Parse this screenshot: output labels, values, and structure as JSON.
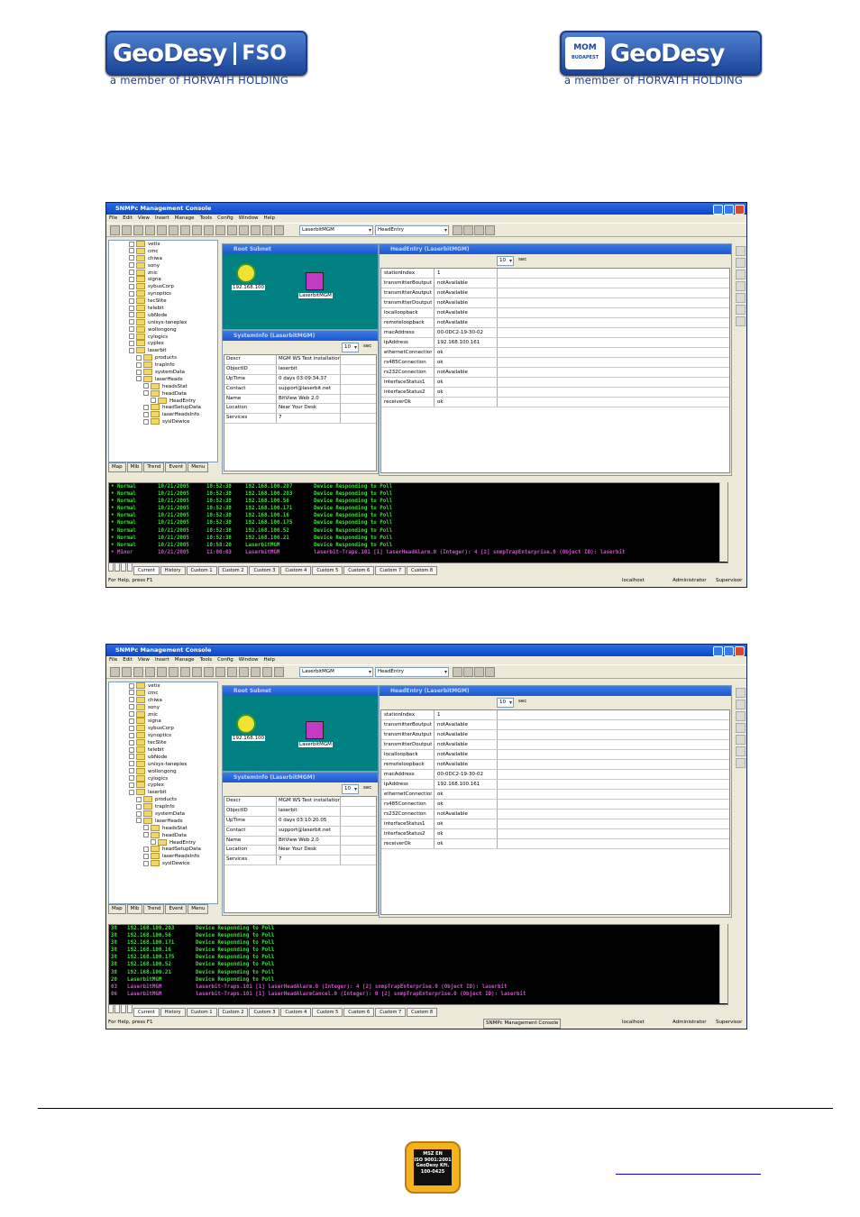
{
  "logos": {
    "left": {
      "brand": "GeoDesy",
      "suffix": "FSO",
      "tagline": "a member of HORVÁTH HOLDING"
    },
    "right": {
      "badge_top": "MOM",
      "badge_bottom": "BUDAPEST",
      "brand": "GeoDesy",
      "tagline": "a member of HORVÁTH HOLDING"
    }
  },
  "window": {
    "title": "SNMPc Management Console",
    "menu": [
      "File",
      "Edit",
      "View",
      "Insert",
      "Manage",
      "Tools",
      "Config",
      "Window",
      "Help"
    ],
    "map_combo": "LaserbitMGM",
    "table_combo": "HeadEntry",
    "tree": [
      "vetix",
      "cmc",
      "chiwa",
      "sony",
      "znic",
      "signa",
      "sybusCorp",
      "synoptics",
      "tecSlite",
      "telebit",
      "ubNode",
      "unisys-taneplex",
      "wollongong",
      "cylogics",
      "cyplex",
      "laserbit",
      "products",
      "trapInfo",
      "systemData",
      "laserHeads",
      "headsStat",
      "headData",
      "HeadEntry",
      "headSetupData",
      "laserHeadsInfo",
      "syslDewice"
    ],
    "tree_tabs": [
      "Map",
      "Mib",
      "Trend",
      "Event",
      "Menu"
    ],
    "root_subnet_title": "Root Subnet",
    "node1_label": "192.168.100",
    "node2_label": "LaserbitMGM",
    "sysinfo_title": "SystemInfo (LaserbitMGM)",
    "poll_value": "10",
    "poll_unit": "sec",
    "sysinfo_rows_a": [
      {
        "k": "Descr",
        "v": "MGM WS Test installation"
      },
      {
        "k": "ObjectID",
        "v": "laserbit"
      },
      {
        "k": "UpTime",
        "v": "0 days 03:09:34.37"
      },
      {
        "k": "Contact",
        "v": "support@laserbit.net"
      },
      {
        "k": "Name",
        "v": "BitView Web 2.0"
      },
      {
        "k": "Location",
        "v": "Near Your Desk"
      },
      {
        "k": "Services",
        "v": "7"
      }
    ],
    "sysinfo_rows_b": [
      {
        "k": "Descr",
        "v": "MGM WS Test installation"
      },
      {
        "k": "ObjectID",
        "v": "laserbit"
      },
      {
        "k": "UpTime",
        "v": "0 days 03:10:20.05"
      },
      {
        "k": "Contact",
        "v": "support@laserbit.net"
      },
      {
        "k": "Name",
        "v": "BitView Web 2.0"
      },
      {
        "k": "Location",
        "v": "Near Your Desk"
      },
      {
        "k": "Services",
        "v": "7"
      }
    ],
    "headentry_title": "HeadEntry (LaserbitMGM)",
    "headentry_rows": [
      {
        "k": "stationIndex",
        "v": "1"
      },
      {
        "k": "transmitterBoutput",
        "v": "notAvailable"
      },
      {
        "k": "transmitterAoutput",
        "v": "notAvailable"
      },
      {
        "k": "transmitterDoutput",
        "v": "notAvailable"
      },
      {
        "k": "localloopback",
        "v": "notAvailable"
      },
      {
        "k": "remoteloopback",
        "v": "notAvailable"
      },
      {
        "k": "macAddress",
        "v": "00-0DC2-19-30-02"
      },
      {
        "k": "ipAddress",
        "v": "192.168.100.161"
      },
      {
        "k": "ethernetConnection",
        "v": "ok"
      },
      {
        "k": "rs485Connection",
        "v": "ok"
      },
      {
        "k": "rs232Connection",
        "v": "notAvailable"
      },
      {
        "k": "interfaceStatus1",
        "v": "ok"
      },
      {
        "k": "interfaceStatus2",
        "v": "ok"
      },
      {
        "k": "receiverOk",
        "v": "ok"
      }
    ],
    "console_a": [
      {
        "c1": "• Normal",
        "c2": "10/21/2005",
        "c3": "10:52:38",
        "c4": "192.168.100.207",
        "c5": "Device Responding to Poll",
        "color": "#3cde3c"
      },
      {
        "c1": "• Normal",
        "c2": "10/21/2005",
        "c3": "10:52:38",
        "c4": "192.168.100.203",
        "c5": "Device Responding to Poll",
        "color": "#3cde3c"
      },
      {
        "c1": "• Normal",
        "c2": "10/21/2005",
        "c3": "10:52:38",
        "c4": "192.168.100.56",
        "c5": "Device Responding to Poll",
        "color": "#3cde3c"
      },
      {
        "c1": "• Normal",
        "c2": "10/21/2005",
        "c3": "10:52:38",
        "c4": "192.168.100.171",
        "c5": "Device Responding to Poll",
        "color": "#3cde3c"
      },
      {
        "c1": "• Normal",
        "c2": "10/21/2005",
        "c3": "10:52:38",
        "c4": "192.168.100.16",
        "c5": "Device Responding to Poll",
        "color": "#3cde3c"
      },
      {
        "c1": "• Normal",
        "c2": "10/21/2005",
        "c3": "10:52:38",
        "c4": "192.168.100.175",
        "c5": "Device Responding to Poll",
        "color": "#3cde3c"
      },
      {
        "c1": "• Normal",
        "c2": "10/21/2005",
        "c3": "10:52:38",
        "c4": "192.168.100.52",
        "c5": "Device Responding to Poll",
        "color": "#3cde3c"
      },
      {
        "c1": "• Normal",
        "c2": "10/21/2005",
        "c3": "10:52:38",
        "c4": "192.168.100.21",
        "c5": "Device Responding to Poll",
        "color": "#3cde3c"
      },
      {
        "c1": "• Normal",
        "c2": "10/21/2005",
        "c3": "10:58:20",
        "c4": "LaserbitMGM",
        "c5": "Device Responding to Poll",
        "color": "#3cde3c"
      },
      {
        "c1": "• Minor",
        "c2": "10/21/2005",
        "c3": "11:00:03",
        "c4": "LaserbitMGM",
        "c5": "laserbit-Traps.101 [1] laserHeadAlarm.0 (Integer): 4 [2] snmpTrapEnterprise.0 (Object ID): laserbit",
        "color": "#d04fd0"
      }
    ],
    "console_b": [
      {
        "c1": "38",
        "c4": "192.168.100.203",
        "c5": "Device Responding to Poll",
        "color": "#3cde3c"
      },
      {
        "c1": "38",
        "c4": "192.168.100.56",
        "c5": "Device Responding to Poll",
        "color": "#3cde3c"
      },
      {
        "c1": "38",
        "c4": "192.168.100.171",
        "c5": "Device Responding to Poll",
        "color": "#3cde3c"
      },
      {
        "c1": "38",
        "c4": "192.168.100.16",
        "c5": "Device Responding to Poll",
        "color": "#3cde3c"
      },
      {
        "c1": "38",
        "c4": "192.168.100.175",
        "c5": "Device Responding to Poll",
        "color": "#3cde3c"
      },
      {
        "c1": "38",
        "c4": "192.168.100.52",
        "c5": "Device Responding to Poll",
        "color": "#3cde3c"
      },
      {
        "c1": "38",
        "c4": "192.168.100.21",
        "c5": "Device Responding to Poll",
        "color": "#3cde3c"
      },
      {
        "c1": "20",
        "c4": "LaserbitMGM",
        "c5": "Device Responding to Poll",
        "color": "#3cde3c"
      },
      {
        "c1": "03",
        "c4": "LaserbitMGM",
        "c5": "laserbit-Traps.101 [1] laserHeadAlarm.0 (Integer): 4 [2] snmpTrapEnterprise.0 (Object ID): laserbit",
        "color": "#d04fd0"
      },
      {
        "c1": "06",
        "c4": "LaserbitMGM",
        "c5": "laserbit-Traps.101 [1] laserHeadAlarmCancel.0 (Integer): 0 [2] snmpTrapEnterprise.0 (Object ID): laserbit",
        "color": "#d04fd0"
      }
    ],
    "console_tabs": [
      "Current",
      "History",
      "Custom 1",
      "Custom 2",
      "Custom 3",
      "Custom 4",
      "Custom 5",
      "Custom 6",
      "Custom 7",
      "Custom 8"
    ],
    "status_help": "For Help, press F1",
    "status_host": "localhost",
    "status_user": "Administrator",
    "status_role": "Supervisor",
    "status_task": "SNMPc Management Console"
  },
  "footer": {
    "badge_text": [
      "MSZ EN",
      "ISO 9001:2001",
      "GeoDesy Kft.",
      "100-0425"
    ]
  }
}
